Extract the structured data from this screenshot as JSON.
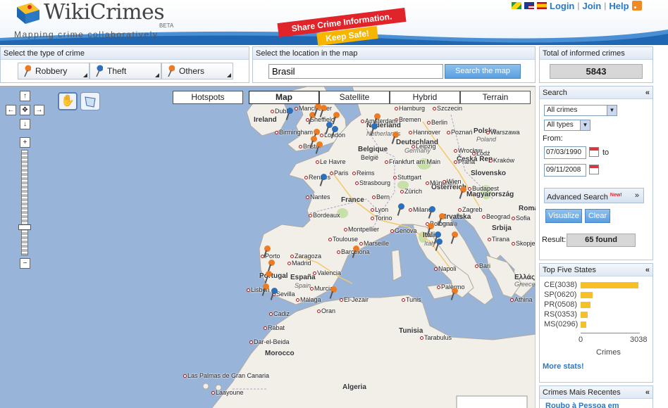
{
  "header": {
    "logo_text": "WikiCrimes",
    "beta": "BETA",
    "tagline": "Mapping crime collaboratively",
    "banner_top": "Share Crime Information.",
    "banner_bottom": "Keep Safe!",
    "nav": {
      "login": "Login",
      "join": "Join",
      "help": "Help",
      "sep": "|"
    }
  },
  "crime_type": {
    "title": "Select the type of crime",
    "buttons": [
      {
        "label": "Robbery",
        "color": "#ee7b22"
      },
      {
        "label": "Theft",
        "color": "#2b6fbf"
      },
      {
        "label": "Others",
        "color": "#ee7b22"
      }
    ]
  },
  "location": {
    "title": "Select the location in the map",
    "value": "Brasil",
    "search_button": "Search the map"
  },
  "total": {
    "title": "Total of informed crimes",
    "value": "5843"
  },
  "map": {
    "types": [
      "Hotspots",
      "Map",
      "Satellite",
      "Hybrid",
      "Terrain"
    ],
    "active_type": "Map",
    "countries": [
      "Ireland",
      "Nederland",
      "Deutschland",
      "Belgique",
      "België",
      "France",
      "Polska",
      "Česká Rep.",
      "Slovensko",
      "Österreich",
      "Magyarország",
      "Hrvatska",
      "Srbija",
      "Italia",
      "Portugal",
      "España",
      "Morocco",
      "Algeria",
      "Tunisia",
      "Ελλάς",
      "Roma"
    ],
    "cities": [
      "Dublin",
      "Manchester",
      "Sheffield",
      "Birmingham",
      "London",
      "Bristol",
      "Hamburg",
      "Szczecin",
      "Bremen",
      "Berlin",
      "Hannover",
      "Poznań",
      "Warszawa",
      "Amsterdam",
      "Leipzig",
      "Wrocław",
      "Łódź",
      "Kraków",
      "Frankfurt am Main",
      "Le Havre",
      "Paris",
      "Reims",
      "Rennes",
      "Strasbourg",
      "Stuttgart",
      "München",
      "Praha",
      "Wien",
      "Nantes",
      "Bern",
      "Zürich",
      "Budapest",
      "Lyon",
      "Milano",
      "Zagreb",
      "Beograd",
      "Bordeaux",
      "Torino",
      "Genova",
      "Bologna",
      "Montpellier",
      "Toulouse",
      "Marseille",
      "Porto",
      "Zaragoza",
      "Barcelona",
      "Madrid",
      "Valencia",
      "Lisbon",
      "Sevilla",
      "Murcia",
      "Málaga",
      "Cadiz",
      "Oran",
      "El-Jezair",
      "Tunis",
      "Napoli",
      "Bari",
      "Palermo",
      "Tirana",
      "Sofia",
      "Skopje",
      "Athina",
      "Rabat",
      "Dar-el-Beida",
      "Las Palmas de Gran Canaria",
      "Laayoune",
      "Tarabulus"
    ],
    "regions": [
      "Germany",
      "Netherlands",
      "Poland",
      "Croatia",
      "Greece",
      "Spain",
      "Italy"
    ]
  },
  "search_panel": {
    "title": "Search",
    "collapse": "«",
    "crimes_select": "All crimes",
    "types_select": "All types",
    "from_label": "From:",
    "from_date": "07/03/1990",
    "to_label": "to",
    "to_date": "09/11/2008",
    "advanced_search": "Advanced Search",
    "new_badge": "New!",
    "visualize": "Visualize",
    "clear": "Clear",
    "result_label": "Result:",
    "result_value": "65 found"
  },
  "top_states": {
    "title": "Top Five States",
    "collapse": "«",
    "states": [
      {
        "label": "CE(3038)",
        "value": 3038
      },
      {
        "label": "SP(0620)",
        "value": 620
      },
      {
        "label": "PR(0508)",
        "value": 508
      },
      {
        "label": "RS(0353)",
        "value": 353
      },
      {
        "label": "MS(0296)",
        "value": 296
      }
    ],
    "axis_min": "0",
    "axis_max": "3038",
    "axis_label": "Crimes",
    "more_stats": "More stats!"
  },
  "recent": {
    "title": "Crimes Mais Recentes",
    "collapse": "«",
    "first_item": "Roubo à Pessoa em"
  },
  "colors": {
    "robbery": "#ee7b22",
    "theft": "#2b6fbf",
    "bar": "#f7c028",
    "link": "#2b78c4"
  }
}
